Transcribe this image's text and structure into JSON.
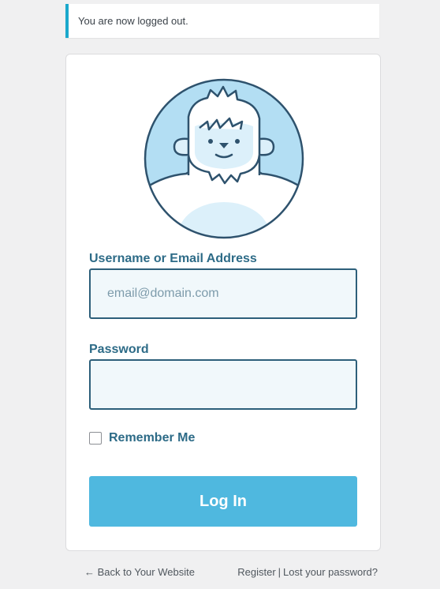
{
  "notice": {
    "message": "You are now logged out."
  },
  "form": {
    "username_label": "Username or Email Address",
    "username_placeholder": "email@domain.com",
    "username_value": "",
    "password_label": "Password",
    "password_value": "",
    "remember_label": "Remember Me",
    "remember_checked": false,
    "submit_label": "Log In"
  },
  "footer": {
    "back_link": "← Back to Your Website",
    "register_link": "Register",
    "separator": "|",
    "lost_password_link": "Lost your password?"
  },
  "colors": {
    "accent": "#1aa8cc",
    "button": "#4fb8df",
    "label": "#2d6b87",
    "input_border": "#2d5f7a",
    "input_bg": "#f1f8fb",
    "avatar_bg": "#b3def3"
  },
  "icons": {
    "avatar": "yeti-avatar-icon"
  }
}
